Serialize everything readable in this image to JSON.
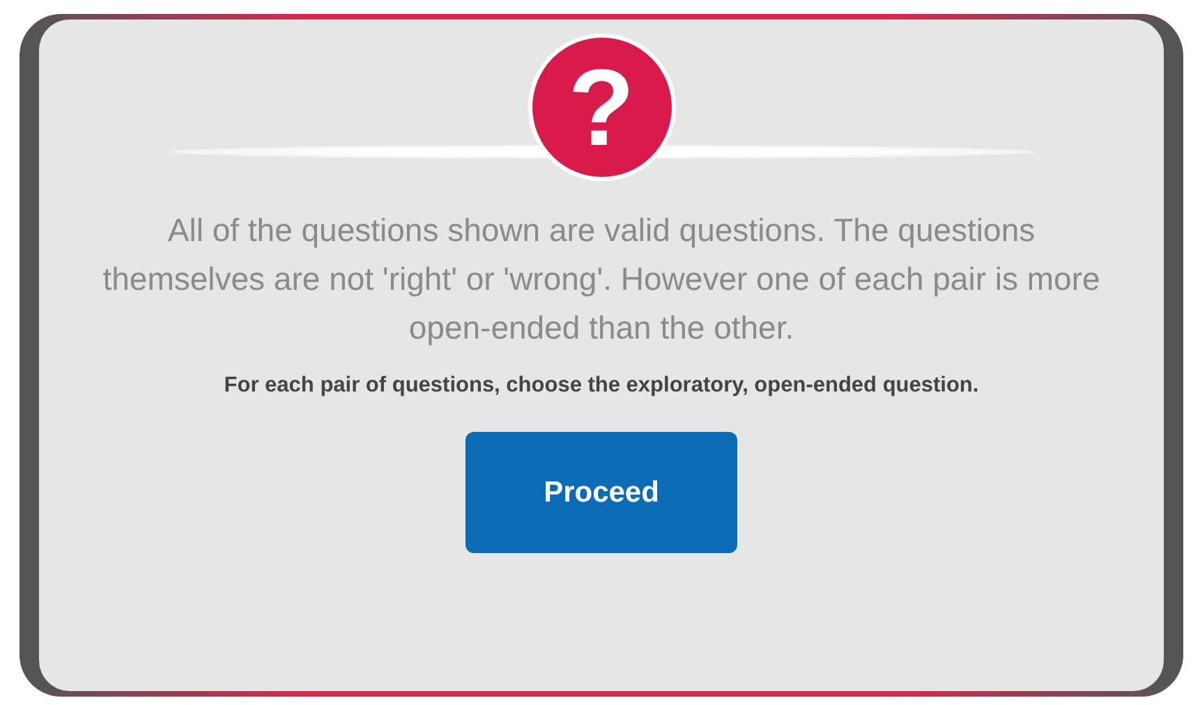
{
  "dialog": {
    "icon_glyph": "?",
    "message": "All of the questions shown are valid questions. The questions themselves are not 'right' or 'wrong'. However one of each pair is more open-ended than the other.",
    "instruction": "For each pair of questions, choose the exploratory, open-ended question.",
    "button": "Proceed"
  }
}
